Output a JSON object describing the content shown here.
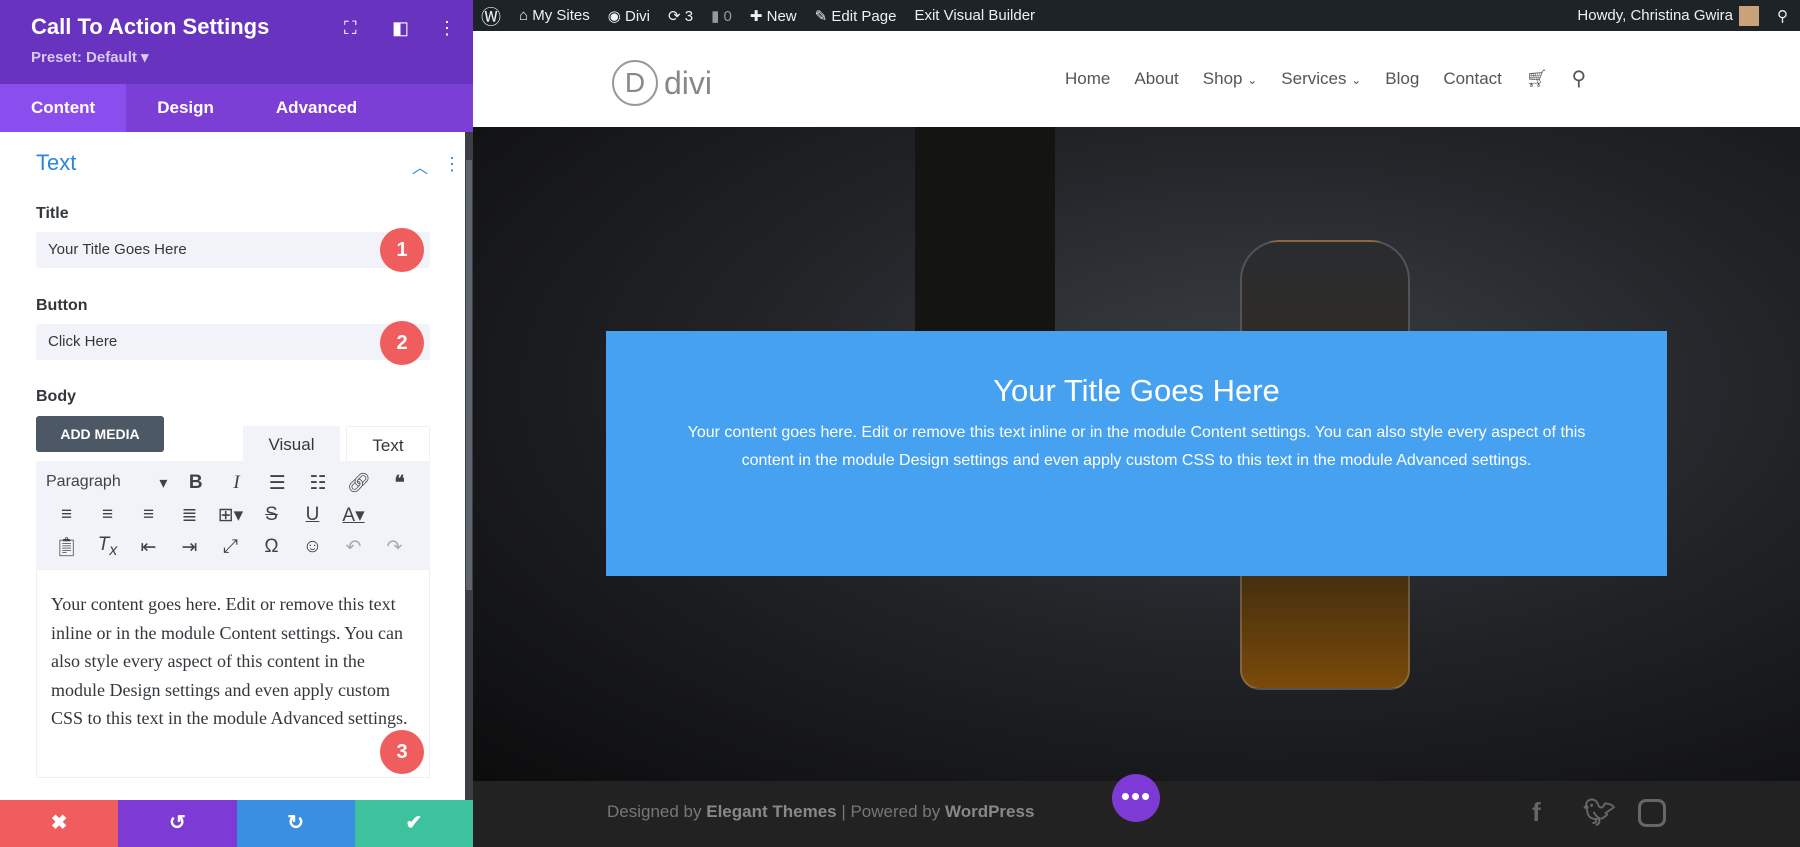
{
  "sidebar": {
    "title": "Call To Action Settings",
    "preset": "Preset: Default ▾",
    "tabs": [
      {
        "label": "Content"
      },
      {
        "label": "Design"
      },
      {
        "label": "Advanced"
      }
    ],
    "section": "Text",
    "fields": {
      "title_label": "Title",
      "title_value": "Your Title Goes Here",
      "button_label": "Button",
      "button_value": "Click Here",
      "body_label": "Body"
    },
    "add_media": "ADD MEDIA",
    "editor_tabs": [
      "Visual",
      "Text"
    ],
    "format_select": "Paragraph",
    "body_text": "Your content goes here. Edit or remove this text inline or in the module Content settings. You can also style every aspect of this content in the module Design settings and even apply custom CSS to this text in the module Advanced settings.",
    "badges": [
      "1",
      "2",
      "3"
    ],
    "bottom": {
      "cancel": "✖",
      "undo": "↺",
      "redo": "↻",
      "save": "✔"
    }
  },
  "adminbar": {
    "my_sites": "My Sites",
    "site": "Divi",
    "updates": "3",
    "comments": "0",
    "new": "New",
    "edit_page": "Edit Page",
    "exit": "Exit Visual Builder",
    "howdy": "Howdy, Christina Gwira"
  },
  "site": {
    "logo": "divi",
    "logo_letter": "D",
    "nav": [
      "Home",
      "About",
      "Shop",
      "Services",
      "Blog",
      "Contact"
    ],
    "cta_title": "Your Title Goes Here",
    "cta_body": "Your content goes here. Edit or remove this text inline or in the module Content settings. You can also style every aspect of this content in the module Design settings and even apply custom CSS to this text in the module Advanced settings.",
    "footer": {
      "designed": "Designed by ",
      "elegant": "Elegant Themes",
      "sep": " | Powered by ",
      "wp": "WordPress"
    },
    "fab": "•••"
  },
  "colors": {
    "purple": "#6833be",
    "cta": "#47a1f1",
    "badge": "#ef5d5f"
  }
}
